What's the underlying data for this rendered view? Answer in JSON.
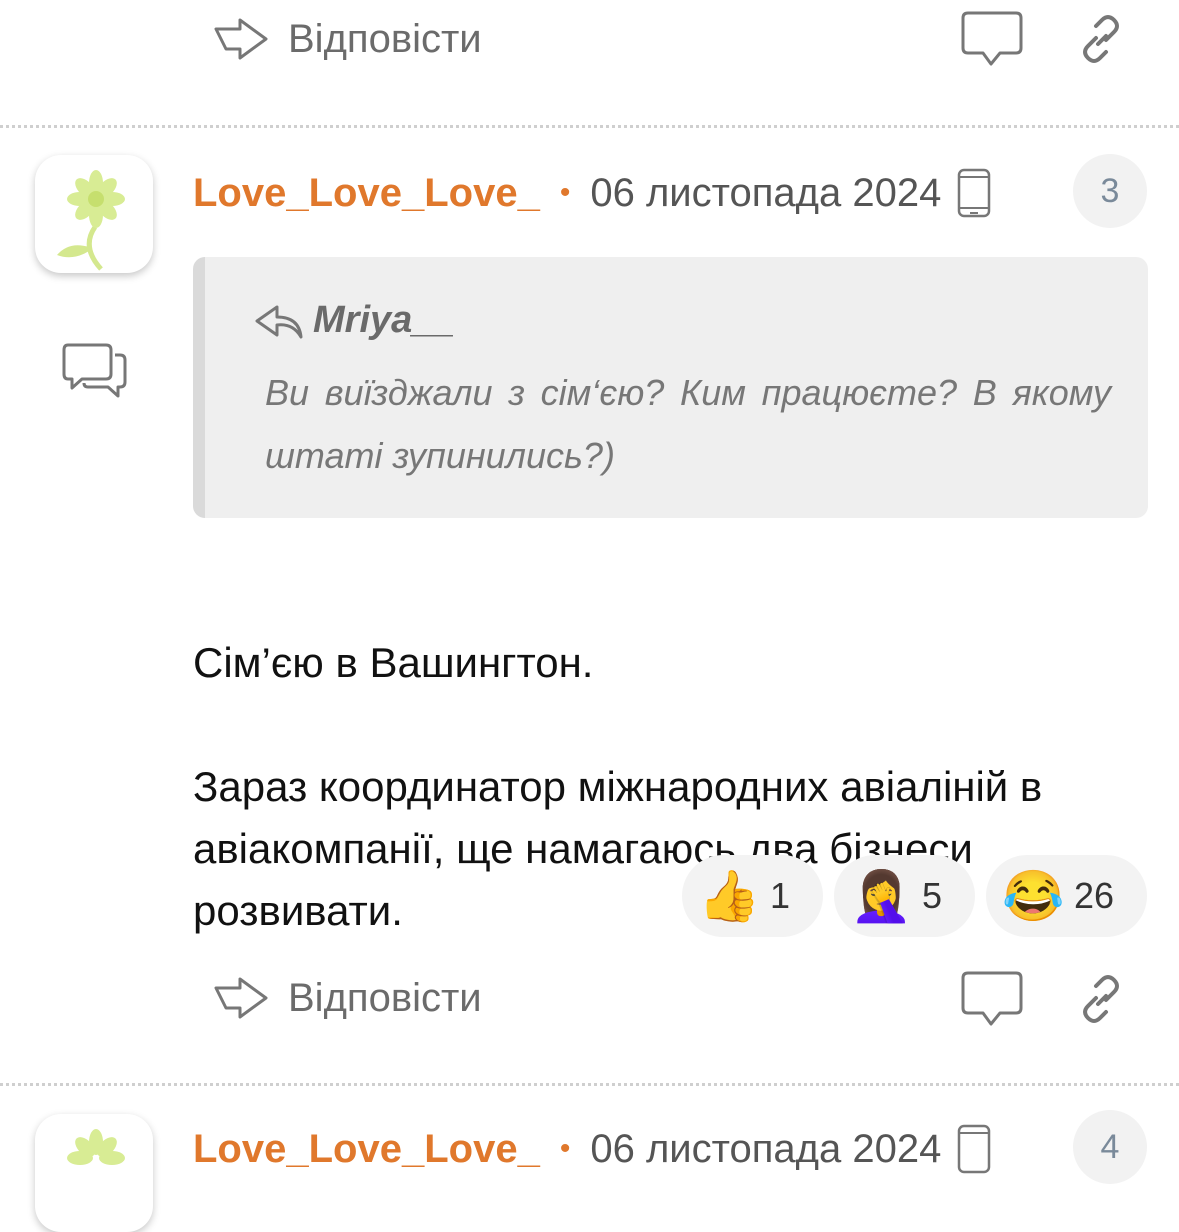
{
  "top_action_bar": {
    "reply_label": "Відповісти",
    "reply_icon": "reply-arrow-icon",
    "comment_icon": "speech-bubble-icon",
    "link_icon": "link-icon"
  },
  "comment": {
    "author": "Love_Love_Love_",
    "separator": "•",
    "date": "06 листопада 2024",
    "device_icon": "phone-icon",
    "number": "3",
    "avatar_icon": "flower-icon",
    "thread_icon": "chat-bubbles-icon",
    "quote": {
      "author": "Mriya__",
      "text": "Ви виїзджали з сім‘єю? Ким працюєте? В якому штаті зупинились?)"
    },
    "body_lines": [
      "Сім’єю в Вашингтон.",
      "Зараз координатор міжнародних авіаліній в авіакомпанії, ще намагаюсь два бізнеси розвивати."
    ],
    "reactions": [
      {
        "emoji": "👍",
        "count": "1",
        "name": "thumbs-up"
      },
      {
        "emoji": "🤦‍♀️",
        "count": "5",
        "name": "facepalm"
      },
      {
        "emoji": "😂",
        "count": "26",
        "name": "laughing"
      }
    ],
    "reply_label": "Відповісти"
  },
  "next_comment": {
    "author": "Love_Love_Love_",
    "separator": "•",
    "date": "06 листопада 2024",
    "number": "4"
  }
}
